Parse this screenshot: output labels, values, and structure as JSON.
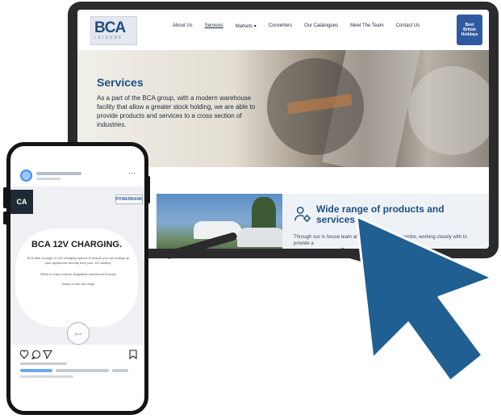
{
  "website": {
    "logo_text": "BCA",
    "logo_sub": "LEISURE",
    "nav": [
      "About Us",
      "Services",
      "Markets",
      "Converters",
      "Our Catalogues",
      "Meet The Team",
      "Contact Us"
    ],
    "nav_active_index": 1,
    "markets_caret": "▾",
    "badge_lines": [
      "Best",
      "British",
      "Holidays"
    ],
    "hero_title": "Services",
    "hero_body": "As a part of the BCA group, with a modern warehouse facility that allow a greater stock holding, we are able to provide products and services to a cross section of industries.",
    "feature_title": "Wide range of products and services",
    "feature_body": "Through our in house team and electronics design centre, working closely with to provide a"
  },
  "phone_post": {
    "more_icon": "···",
    "logo_text": "CA",
    "brand_tag": "POWERBANK",
    "title": "BCA 12V CHARGING.",
    "text1": "BCA offer a range of 12V charging options to ensure you can charge up your appliances directly from your 12V battery.",
    "text2": "Fitted in major brands, Adaptable motorhome Europe",
    "text3": "Swipe to see the range",
    "circle_label": "BCA"
  },
  "colors": {
    "brand_blue": "#1f4f82",
    "cursor_blue": "#1f5f92",
    "frame": "#2b2b2d",
    "phone_frame": "#141414"
  },
  "icons": [
    "gear-person-icon",
    "heart-icon",
    "comment-icon",
    "share-icon",
    "bookmark-icon",
    "cursor-arrow-icon"
  ]
}
